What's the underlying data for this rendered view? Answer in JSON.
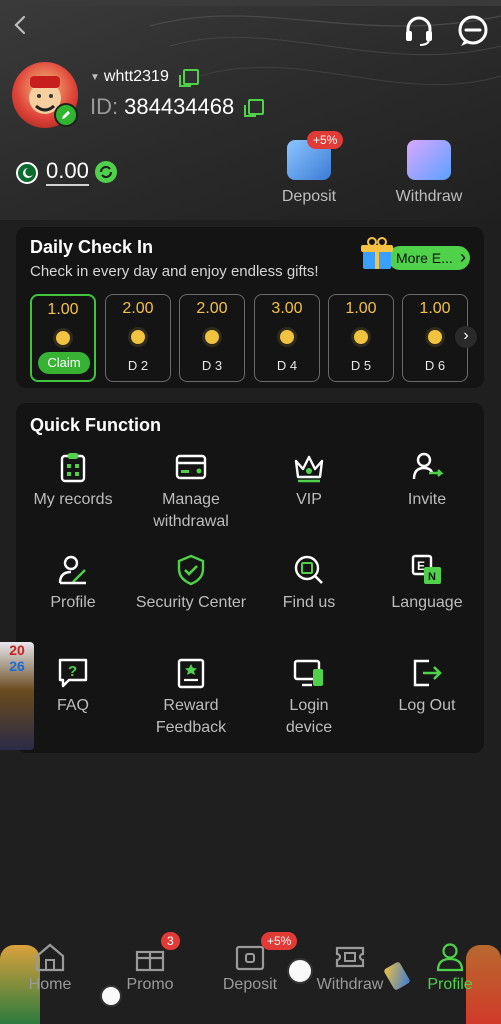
{
  "header": {
    "username": "whtt2319",
    "id_label": "ID:",
    "id_value": "384434468",
    "balance": "0.00",
    "deposit_label": "Deposit",
    "deposit_badge": "+5%",
    "withdraw_label": "Withdraw"
  },
  "checkin": {
    "title": "Daily Check In",
    "subtitle": "Check in every day and enjoy endless gifts!",
    "more_label": "More E...",
    "days": [
      {
        "amount": "1.00",
        "label": "Claim"
      },
      {
        "amount": "2.00",
        "label": "D 2"
      },
      {
        "amount": "2.00",
        "label": "D 3"
      },
      {
        "amount": "3.00",
        "label": "D 4"
      },
      {
        "amount": "1.00",
        "label": "D 5"
      },
      {
        "amount": "1.00",
        "label": "D 6"
      }
    ]
  },
  "quick": {
    "title": "Quick Function",
    "items": [
      {
        "label": "My records",
        "icon": "clipboard-icon"
      },
      {
        "label": "Manage withdrawal",
        "icon": "card-icon"
      },
      {
        "label": "VIP",
        "icon": "crown-icon"
      },
      {
        "label": "Invite",
        "icon": "invite-user-icon"
      },
      {
        "label": "Profile",
        "icon": "profile-edit-icon"
      },
      {
        "label": "Security Center",
        "icon": "shield-check-icon"
      },
      {
        "label": "Find us",
        "icon": "search-doc-icon"
      },
      {
        "label": "Language",
        "icon": "language-icon"
      },
      {
        "label": "FAQ",
        "icon": "question-chat-icon"
      },
      {
        "label": "Reward Feedback",
        "icon": "reward-doc-icon"
      },
      {
        "label": "Login device",
        "icon": "device-icon"
      },
      {
        "label": "Log Out",
        "icon": "logout-icon"
      }
    ]
  },
  "side_ad": {
    "top": "20",
    "bottom": "26"
  },
  "nav": {
    "home": "Home",
    "promo": "Promo",
    "promo_badge": "3",
    "deposit": "Deposit",
    "deposit_badge": "+5%",
    "withdraw": "Withdraw",
    "profile": "Profile"
  },
  "colors": {
    "accent": "#4fd14a",
    "badge": "#e23b35",
    "coin": "#f2c33e",
    "card": "#141414",
    "background": "#1f1f1f"
  }
}
